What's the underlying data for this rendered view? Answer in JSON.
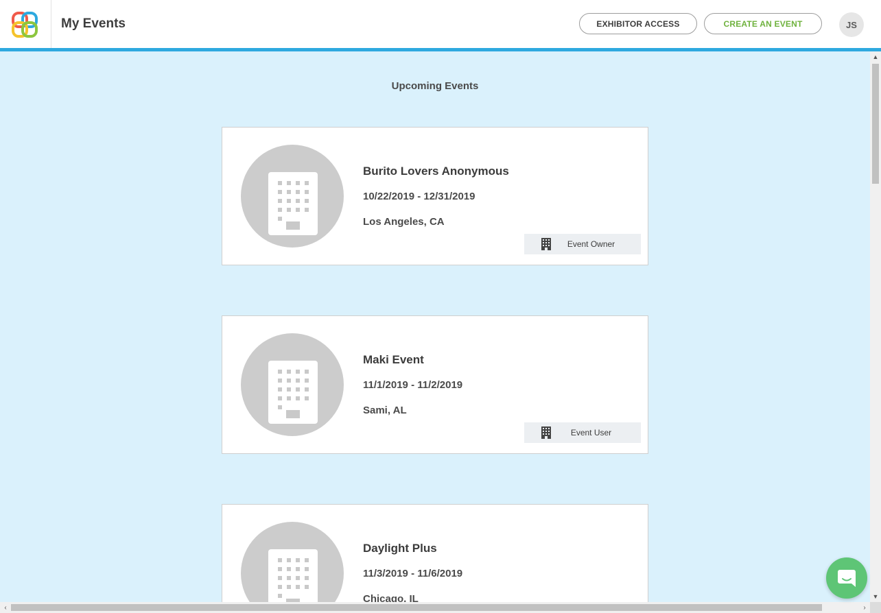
{
  "header": {
    "title": "My Events",
    "exhibitor_label": "EXHIBITOR ACCESS",
    "create_label": "CREATE AN EVENT",
    "avatar_initials": "JS",
    "logo_icon": "interlocking-rings-logo"
  },
  "main": {
    "section_title": "Upcoming Events",
    "events": [
      {
        "name": "Burito Lovers Anonymous",
        "dates": "10/22/2019 - 12/31/2019",
        "location": "Los Angeles, CA",
        "role": "Event Owner",
        "icon": "building-icon"
      },
      {
        "name": "Maki Event",
        "dates": "11/1/2019 - 11/2/2019",
        "location": "Sami, AL",
        "role": "Event User",
        "icon": "building-icon"
      },
      {
        "name": "Daylight Plus",
        "dates": "11/3/2019 - 11/6/2019",
        "location": "Chicago, IL",
        "role": "",
        "icon": "building-icon"
      }
    ]
  },
  "colors": {
    "background": "#daf1fc",
    "header_border": "#2ea9df",
    "create_button_text": "#6fb23e",
    "chat_button": "#5ec576"
  },
  "chat": {
    "icon": "chat-bubble-icon"
  }
}
